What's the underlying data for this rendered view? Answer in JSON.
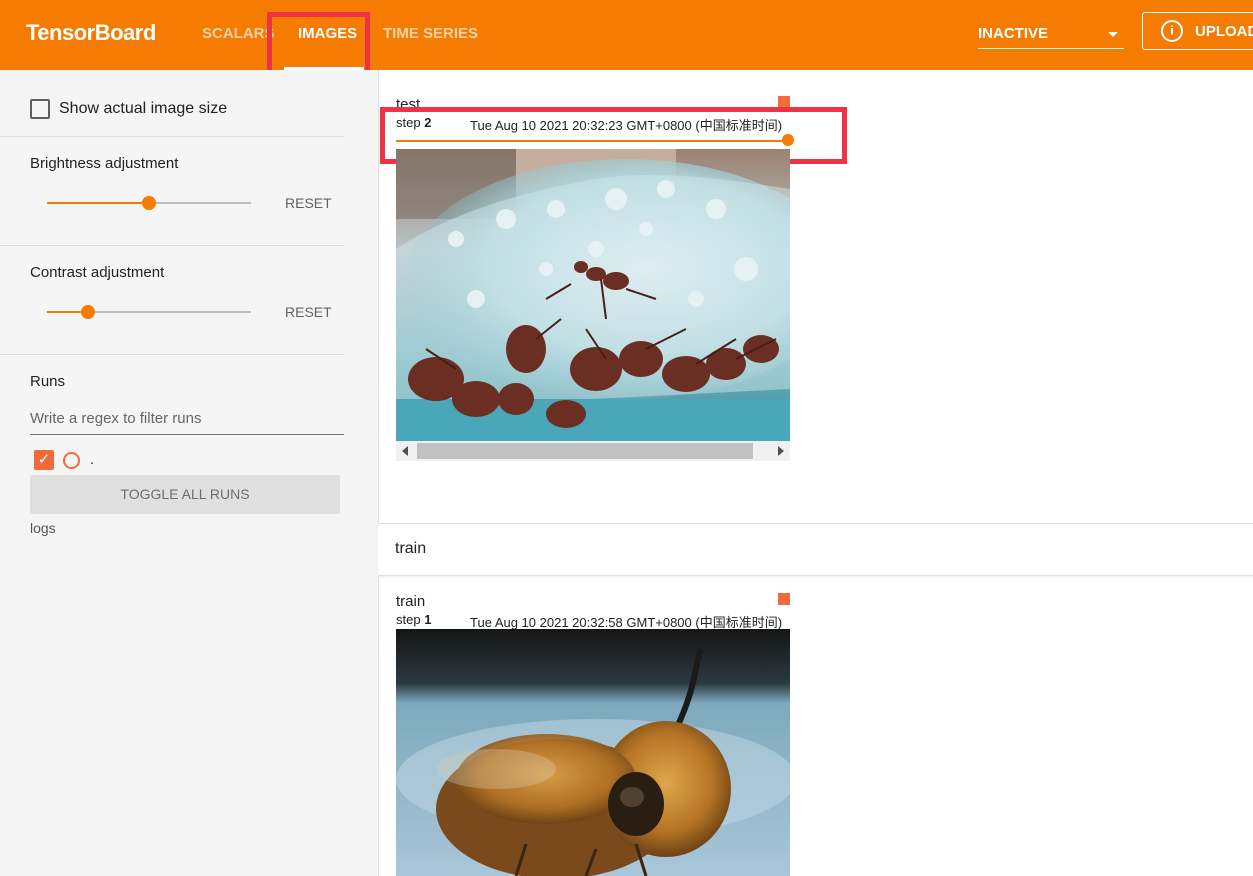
{
  "header": {
    "brand": "TensorBoard",
    "tabs": [
      {
        "label": "SCALARS"
      },
      {
        "label": "IMAGES"
      },
      {
        "label": "TIME SERIES"
      }
    ],
    "active_tab": "IMAGES",
    "run_selector": {
      "label": "INACTIVE"
    },
    "upload": {
      "label": "UPLOAD",
      "icon": "info-icon",
      "icon_glyph": "i"
    }
  },
  "sidebar": {
    "show_actual_size": {
      "label": "Show actual image size",
      "checked": false
    },
    "brightness": {
      "label": "Brightness adjustment",
      "value": 0.5,
      "reset": "RESET"
    },
    "contrast": {
      "label": "Contrast adjustment",
      "value": 0.2,
      "reset": "RESET"
    },
    "runs": {
      "title": "Runs",
      "filter_placeholder": "Write a regex to filter runs",
      "items": [
        {
          "label": ".",
          "checked": true
        }
      ],
      "toggle_all": "TOGGLE ALL RUNS",
      "logdir": "logs"
    }
  },
  "main": {
    "test_card": {
      "title": "test",
      "step_prefix": "step",
      "step": "2",
      "timestamp": "Tue Aug 10 2021 20:32:23 GMT+0800 (中国标准时间)",
      "slider_value": 1.0
    },
    "train_group": {
      "title": "train"
    },
    "train_card": {
      "title": "train",
      "step_prefix": "step",
      "step": "1",
      "timestamp": "Tue Aug 10 2021 20:32:58 GMT+0800 (中国标准时间)"
    }
  },
  "colors": {
    "header": "#f57c00",
    "accent": "#f26b3a",
    "highlight": "#ee3344"
  }
}
